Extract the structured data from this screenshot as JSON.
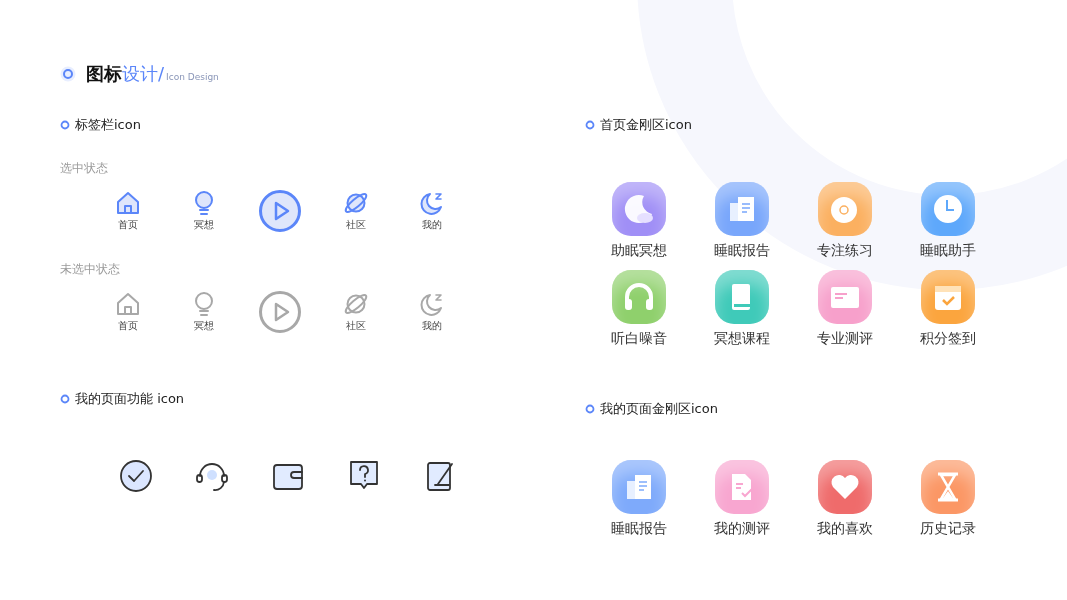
{
  "header": {
    "title": "图标",
    "title_accent": "设计/",
    "subtitle": "Icon Design"
  },
  "tab_bar_section": {
    "heading": "标签栏icon",
    "groups": [
      {
        "label": "选中状态",
        "items": [
          {
            "kind": "home",
            "label": "首页",
            "selected": true
          },
          {
            "kind": "bulb",
            "label": "冥想",
            "selected": true
          },
          {
            "kind": "play",
            "selected": true
          },
          {
            "kind": "planet",
            "label": "社区",
            "selected": true
          },
          {
            "kind": "moon",
            "label": "我的",
            "selected": true
          }
        ]
      },
      {
        "label": "未选中状态",
        "items": [
          {
            "kind": "home",
            "label": "首页",
            "selected": false
          },
          {
            "kind": "bulb",
            "label": "冥想",
            "selected": false
          },
          {
            "kind": "play",
            "selected": false
          },
          {
            "kind": "planet",
            "label": "社区",
            "selected": false
          },
          {
            "kind": "moon",
            "label": "我的",
            "selected": false
          }
        ]
      }
    ]
  },
  "home_section": {
    "heading": "首页金刚区icon",
    "tiles": [
      {
        "kind": "moon",
        "label": "助眠冥想",
        "color": "#a08ff6"
      },
      {
        "kind": "report",
        "label": "睡眠报告",
        "color": "#78a6fb"
      },
      {
        "kind": "disc",
        "label": "专注练习",
        "color": "#fbb060"
      },
      {
        "kind": "clock",
        "label": "睡眠助手",
        "color": "#5ea8fb"
      },
      {
        "kind": "headphones",
        "label": "听白噪音",
        "color": "#8fd06c"
      },
      {
        "kind": "book",
        "label": "冥想课程",
        "color": "#3fcab9"
      },
      {
        "kind": "card",
        "label": "专业测评",
        "color": "#f7a0cb"
      },
      {
        "kind": "calendar",
        "label": "积分签到",
        "color": "#fba53e"
      }
    ]
  },
  "function_section": {
    "heading": "我的页面功能 icon",
    "icons": [
      {
        "kind": "check"
      },
      {
        "kind": "headset"
      },
      {
        "kind": "wallet"
      },
      {
        "kind": "question"
      },
      {
        "kind": "edit"
      }
    ]
  },
  "mine_section": {
    "heading": "我的页面金刚区icon",
    "tiles": [
      {
        "kind": "report",
        "label": "睡眠报告",
        "color": "#7eaafb"
      },
      {
        "kind": "doccheck",
        "label": "我的测评",
        "color": "#f8a6d0"
      },
      {
        "kind": "heart",
        "label": "我的喜欢",
        "color": "#ef6b6b"
      },
      {
        "kind": "hourglass",
        "label": "历史记录",
        "color": "#fb9765"
      }
    ]
  }
}
